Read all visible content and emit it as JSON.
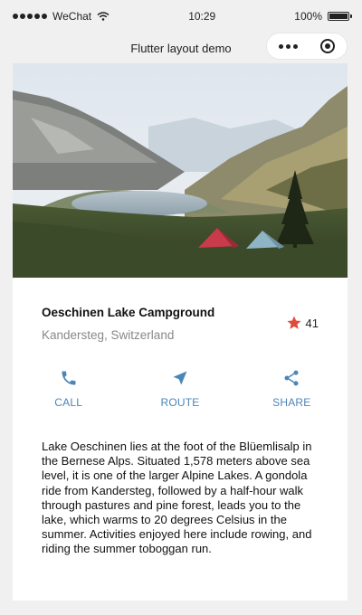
{
  "status_bar": {
    "carrier": "WeChat",
    "time": "10:29",
    "battery": "100%"
  },
  "nav": {
    "title": "Flutter layout demo"
  },
  "place": {
    "name": "Oeschinen Lake Campground",
    "location": "Kandersteg, Switzerland",
    "rating": "41"
  },
  "actions": [
    {
      "label": "CALL",
      "icon": "phone-icon"
    },
    {
      "label": "ROUTE",
      "icon": "navigation-arrow-icon"
    },
    {
      "label": "SHARE",
      "icon": "share-icon"
    }
  ],
  "description": "Lake Oeschinen lies at the foot of the Blüemlisalp in the Bernese Alps. Situated 1,578 meters above sea level, it is one of the larger Alpine Lakes. A gondola ride from Kandersteg, followed by a half-hour walk through pastures and pine forest, leads you to the lake, which warms to 20 degrees Celsius in the summer. Activities enjoyed here include rowing, and riding the summer toboggan run.",
  "colors": {
    "accent": "#4a86b8",
    "star": "#e04b3a"
  }
}
